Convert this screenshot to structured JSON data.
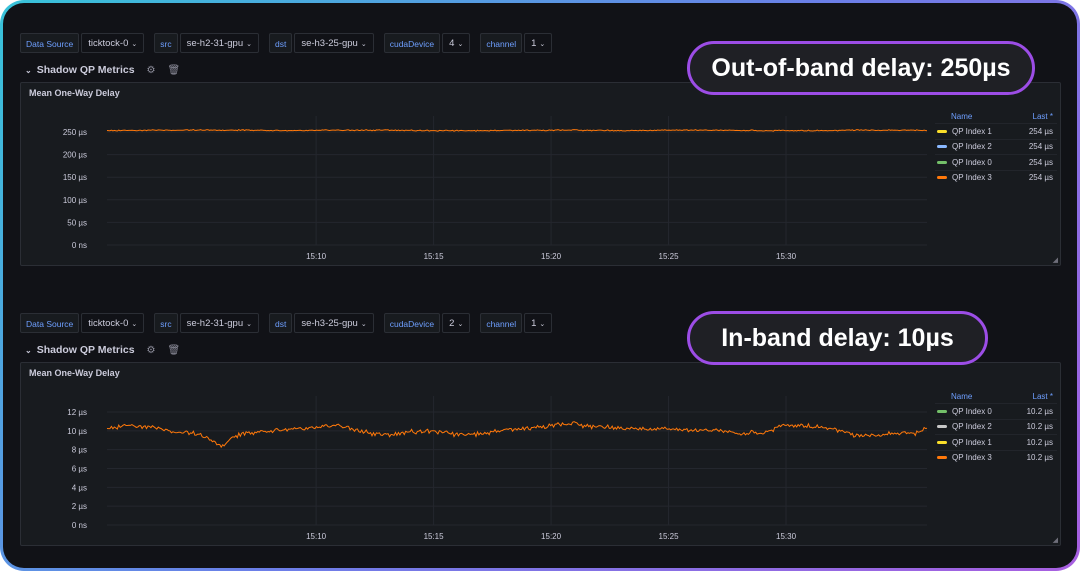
{
  "callouts": [
    "Out-of-band delay: 250µs",
    "In-band delay: 10µs"
  ],
  "sections": [
    {
      "variables": [
        {
          "label": "Data Source",
          "value": "ticktock-0"
        },
        {
          "label": "src",
          "value": "se-h2-31-gpu"
        },
        {
          "label": "dst",
          "value": "se-h3-25-gpu"
        },
        {
          "label": "cudaDevice",
          "value": "4"
        },
        {
          "label": "channel",
          "value": "1"
        }
      ],
      "row_title": "Shadow QP Metrics",
      "panel_title": "Mean One-Way Delay",
      "legend": {
        "name_header": "Name",
        "last_header": "Last *",
        "items": [
          {
            "name": "QP Index 1",
            "last": "254 µs",
            "color": "#fade2a"
          },
          {
            "name": "QP Index 2",
            "last": "254 µs",
            "color": "#8ab8ff"
          },
          {
            "name": "QP Index 0",
            "last": "254 µs",
            "color": "#73bf69"
          },
          {
            "name": "QP Index 3",
            "last": "254 µs",
            "color": "#ff780a"
          }
        ]
      }
    },
    {
      "variables": [
        {
          "label": "Data Source",
          "value": "ticktock-0"
        },
        {
          "label": "src",
          "value": "se-h2-31-gpu"
        },
        {
          "label": "dst",
          "value": "se-h3-25-gpu"
        },
        {
          "label": "cudaDevice",
          "value": "2"
        },
        {
          "label": "channel",
          "value": "1"
        }
      ],
      "row_title": "Shadow QP Metrics",
      "panel_title": "Mean One-Way Delay",
      "legend": {
        "name_header": "Name",
        "last_header": "Last *",
        "items": [
          {
            "name": "QP Index 0",
            "last": "10.2 µs",
            "color": "#73bf69"
          },
          {
            "name": "QP Index 2",
            "last": "10.2 µs",
            "color": "#c7c7c7"
          },
          {
            "name": "QP Index 1",
            "last": "10.2 µs",
            "color": "#fade2a"
          },
          {
            "name": "QP Index 3",
            "last": "10.2 µs",
            "color": "#ff780a"
          }
        ]
      }
    }
  ],
  "chart_data": [
    {
      "type": "line",
      "title": "Mean One-Way Delay",
      "x_ticks": [
        "15:10",
        "15:15",
        "15:20",
        "15:25",
        "15:30"
      ],
      "y_ticks": [
        "0 ns",
        "50 µs",
        "100 µs",
        "150 µs",
        "200 µs",
        "250 µs"
      ],
      "ylim": [
        0,
        250
      ],
      "y_unit": "µs",
      "xlim_minutes": [
        -3.9,
        31.0
      ],
      "series": [
        {
          "name": "QP Index 3",
          "color": "#ff780a",
          "x": [
            -3.9,
            -2,
            0,
            2,
            4,
            6,
            8,
            10,
            12,
            14,
            16,
            18,
            20,
            22,
            24,
            26,
            28,
            30,
            31
          ],
          "values": [
            253,
            254,
            254,
            254,
            253,
            254,
            254,
            253,
            253,
            254,
            254,
            253,
            254,
            254,
            253,
            253,
            254,
            254,
            254
          ]
        }
      ],
      "grid": true,
      "legend_position": "right"
    },
    {
      "type": "line",
      "title": "Mean One-Way Delay",
      "x_ticks": [
        "15:10",
        "15:15",
        "15:20",
        "15:25",
        "15:30"
      ],
      "y_ticks": [
        "0 ns",
        "2 µs",
        "4 µs",
        "6 µs",
        "8 µs",
        "10 µs",
        "12 µs"
      ],
      "ylim": [
        0,
        12
      ],
      "y_unit": "µs",
      "xlim_minutes": [
        -3.9,
        31.0
      ],
      "series": [
        {
          "name": "QP Index 3",
          "color": "#ff780a",
          "x": [
            -3.9,
            -3,
            -2,
            -1,
            0,
            0.5,
            1,
            1.5,
            2,
            3,
            4,
            5,
            6,
            7,
            8,
            9,
            10,
            11,
            12,
            13,
            14,
            15,
            16,
            17,
            18,
            19,
            20,
            21,
            22,
            23,
            24,
            25,
            26,
            27,
            28,
            29,
            30,
            30.5,
            31
          ],
          "values": [
            10.2,
            10.6,
            10.4,
            9.9,
            9.6,
            9.0,
            8.4,
            9.4,
            9.7,
            10.0,
            10.2,
            10.3,
            10.6,
            9.9,
            9.5,
            9.9,
            10.0,
            9.6,
            9.7,
            10.1,
            10.3,
            10.6,
            10.7,
            10.4,
            10.3,
            10.2,
            10.2,
            10.0,
            10.1,
            9.7,
            9.8,
            10.6,
            10.5,
            10.3,
            9.4,
            9.6,
            9.8,
            9.7,
            10.5
          ]
        }
      ],
      "grid": true,
      "legend_position": "right"
    }
  ]
}
